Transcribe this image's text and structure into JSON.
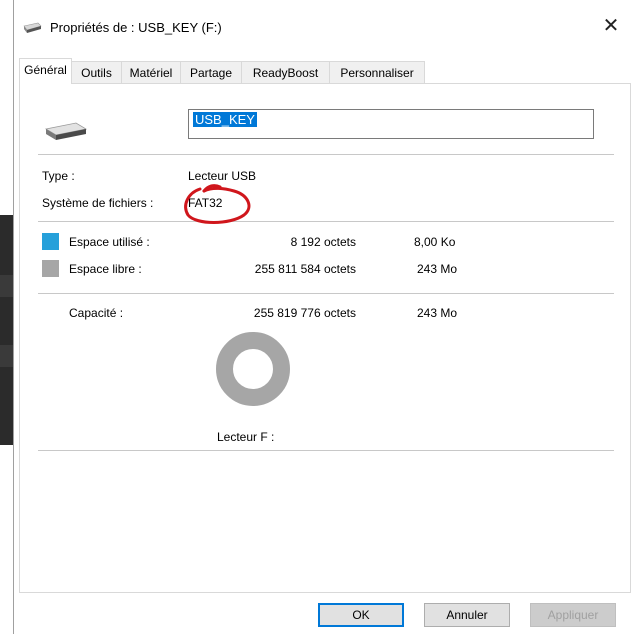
{
  "window": {
    "title": "Propriétés de : USB_KEY (F:)",
    "close_glyph": "✕"
  },
  "tabs": [
    {
      "label": "Général",
      "active": true
    },
    {
      "label": "Outils",
      "active": false
    },
    {
      "label": "Matériel",
      "active": false
    },
    {
      "label": "Partage",
      "active": false
    },
    {
      "label": "ReadyBoost",
      "active": false
    },
    {
      "label": "Personnaliser",
      "active": false
    }
  ],
  "general": {
    "drive_name": "USB_KEY",
    "type_label": "Type :",
    "type_value": "Lecteur USB",
    "fs_label": "Système de fichiers :",
    "fs_value": "FAT32",
    "used_label": "Espace utilisé :",
    "used_bytes": "8 192 octets",
    "used_short": "8,00 Ko",
    "used_color": "#26a0da",
    "free_label": "Espace libre :",
    "free_bytes": "255 811 584 octets",
    "free_short": "243 Mo",
    "free_color": "#a6a6a6",
    "capacity_label": "Capacité :",
    "capacity_bytes": "255 819 776 octets",
    "capacity_short": "243 Mo",
    "drive_caption": "Lecteur F :"
  },
  "annotation": {
    "color": "#d0161c",
    "target": "fs_value"
  },
  "buttons": {
    "ok": "OK",
    "cancel": "Annuler",
    "apply": "Appliquer"
  }
}
